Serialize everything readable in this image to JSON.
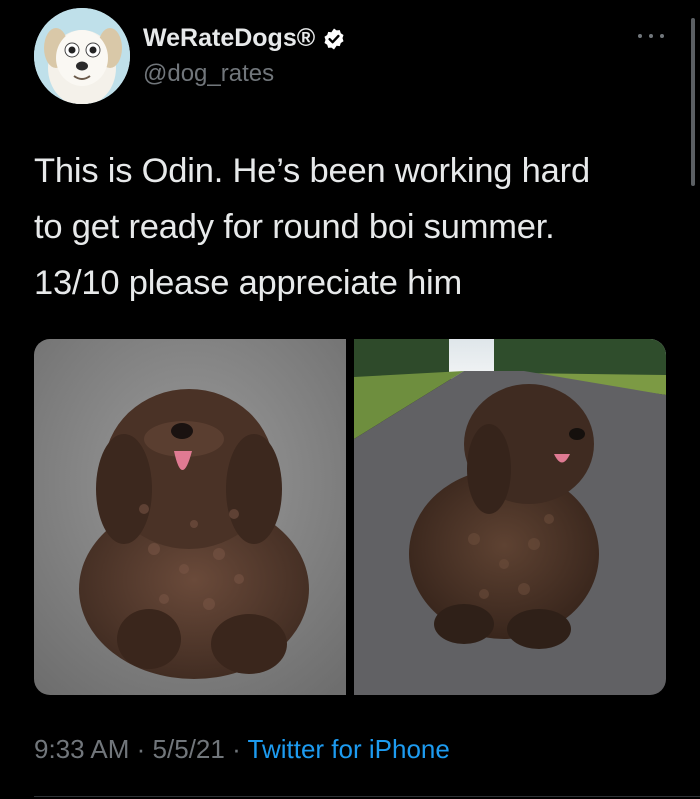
{
  "tweet": {
    "display_name": "WeRateDogs®",
    "handle": "@dog_rates",
    "verified_icon": "verified-badge-icon",
    "more_icon": "more-options-icon",
    "text_lines": [
      "This is Odin. He’s been working hard",
      "to get ready for round boi summer.",
      "13/10 please appreciate him"
    ],
    "time": "9:33 AM",
    "separator": "·",
    "date": "5/5/21",
    "source": "Twitter for iPhone"
  },
  "colors": {
    "background": "#000000",
    "primary_text": "#e7e9ea",
    "secondary_text": "#71767b",
    "link": "#1d9bf0",
    "verified_badge": "#ffffff"
  }
}
